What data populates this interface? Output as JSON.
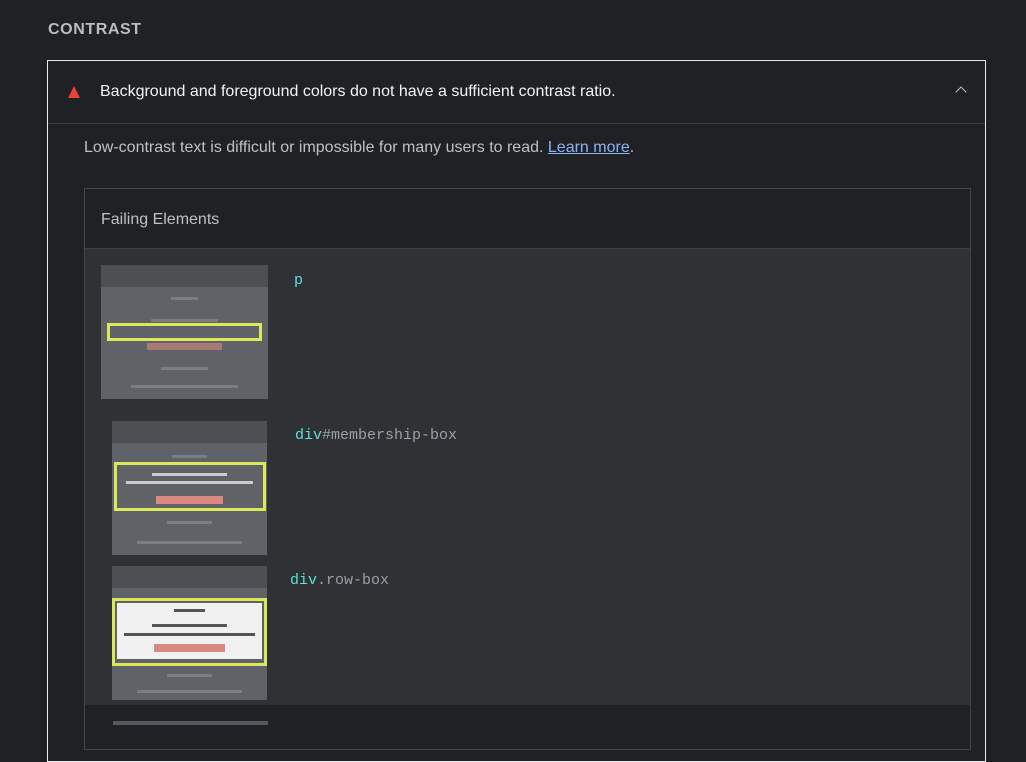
{
  "section": {
    "title": "CONTRAST"
  },
  "audit": {
    "title": "Background and foreground colors do not have a sufficient contrast ratio.",
    "description": "Low-contrast text is difficult or impossible for many users to read.",
    "learn_more": "Learn more",
    "period": ".",
    "status_color": "#e94235",
    "link_color": "#8ab4f8"
  },
  "table": {
    "header": "Failing Elements",
    "rows": [
      {
        "tag": "p",
        "rest": "",
        "thumbnail": "element-screenshot"
      },
      {
        "tag": "div",
        "rest": "#membership-box",
        "thumbnail": "element-screenshot"
      },
      {
        "tag": "div",
        "rest": ".row-box",
        "thumbnail": "element-screenshot"
      }
    ]
  },
  "colors": {
    "selector_tag": "#5ce2d5",
    "highlight": "#dbe85a",
    "background": "#202124"
  }
}
